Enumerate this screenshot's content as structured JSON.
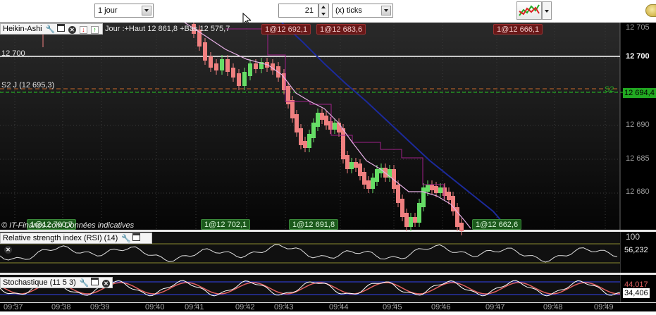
{
  "toolbar": {
    "period_select": "1 jour",
    "ticks_value": "21",
    "ticks_unit_select": "(x) ticks"
  },
  "main_panel": {
    "indicator_name": "Heikin-Ashi",
    "info_text": "Jour :+Haut 12 861,8 +Bas 12 575,7",
    "level_12700": "12 700",
    "level_s2": "S2 J (12 695,3)",
    "s2_marker": "S2",
    "footer": "© IT-Finance.com Données indicatives",
    "top_tags": [
      "1@12 692,1",
      "1@12 683,6",
      "1@12 666,1"
    ],
    "bottom_tags": [
      "1@12 700,7",
      "1@12 702,1",
      "1@12 691,8",
      "1@12 662,6"
    ],
    "y_axis": [
      "12 705",
      "12 700",
      "12 690",
      "12 685",
      "12 680"
    ],
    "current_price": "12 694,4"
  },
  "rsi_panel": {
    "label": "Relative strength index (RSI) (14)",
    "axis_top": "100",
    "value": "56,232"
  },
  "stoch_panel": {
    "label": "Stochastique (11 5 3)",
    "value_k": "44,017",
    "value_d": "34,406"
  },
  "x_axis": [
    "09:37",
    "09:38",
    "09:39",
    "09:40",
    "09:41",
    "09:42",
    "09:43",
    "09:44",
    "09:45",
    "09:46",
    "09:47",
    "09:48",
    "09:49"
  ],
  "colors": {
    "bull": "#66dd66",
    "bear": "#f08080",
    "ma_fast": "#e6b0e6",
    "ma_slow": "#1c2a9a",
    "s2_line": "#22aa22",
    "resist_line": "#ffffff"
  }
}
